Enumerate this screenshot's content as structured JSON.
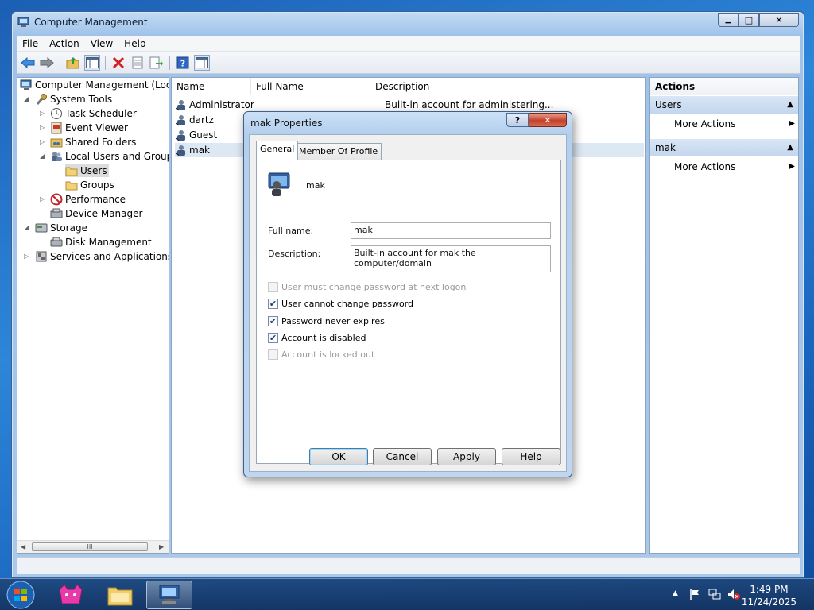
{
  "window": {
    "title": "Computer Management",
    "minimize": "▁",
    "maximize": "□",
    "close": "✕"
  },
  "menu": [
    "File",
    "Action",
    "View",
    "Help"
  ],
  "tree": {
    "root": "Computer Management (Local",
    "system_tools": "System Tools",
    "task_scheduler": "Task Scheduler",
    "event_viewer": "Event Viewer",
    "shared_folders": "Shared Folders",
    "local_users_groups": "Local Users and Groups",
    "users": "Users",
    "groups": "Groups",
    "performance": "Performance",
    "device_manager": "Device Manager",
    "storage": "Storage",
    "disk_management": "Disk Management",
    "services_apps": "Services and Applications",
    "scroll_grip": "III"
  },
  "list": {
    "columns": [
      "Name",
      "Full Name",
      "Description"
    ],
    "rows": [
      {
        "name": "Administrator",
        "full_name": "",
        "description": "Built-in account for administering..."
      },
      {
        "name": "dartz",
        "full_name": "",
        "description": ""
      },
      {
        "name": "Guest",
        "full_name": "",
        "description": ""
      },
      {
        "name": "mak",
        "full_name": "",
        "description": ""
      }
    ]
  },
  "actions": {
    "header": "Actions",
    "sections": [
      {
        "title": "Users",
        "item": "More Actions"
      },
      {
        "title": "mak",
        "item": "More Actions"
      }
    ]
  },
  "dialog": {
    "title": "mak Properties",
    "help_btn": "?",
    "close_btn": "✕",
    "tabs": [
      "General",
      "Member Of",
      "Profile"
    ],
    "user_name": "mak",
    "full_name_label": "Full name:",
    "full_name_value": "mak",
    "description_label": "Description:",
    "description_value": "Built-in account for mak the computer/domain",
    "checkboxes": [
      {
        "label": "User must change password at next logon",
        "checked": false,
        "disabled": true
      },
      {
        "label": "User cannot change password",
        "checked": true,
        "disabled": false
      },
      {
        "label": "Password never expires",
        "checked": true,
        "disabled": false
      },
      {
        "label": "Account is disabled",
        "checked": true,
        "disabled": false
      },
      {
        "label": "Account is locked out",
        "checked": false,
        "disabled": true
      }
    ],
    "buttons": {
      "ok": "OK",
      "cancel": "Cancel",
      "apply": "Apply",
      "help": "Help"
    }
  },
  "taskbar": {
    "time": "1:49 PM",
    "date": "11/24/2025",
    "tray_arrow": "▲"
  }
}
